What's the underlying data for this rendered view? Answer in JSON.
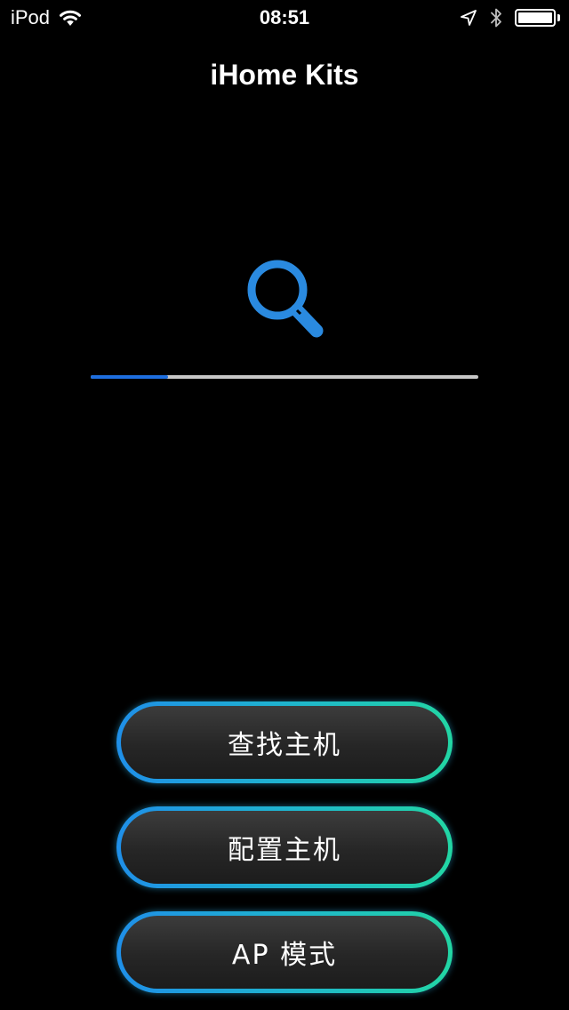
{
  "status_bar": {
    "carrier": "iPod",
    "time": "08:51",
    "icons": [
      "wifi-icon",
      "location-arrow-icon",
      "bluetooth-icon",
      "battery-icon"
    ]
  },
  "nav": {
    "title": "iHome Kits"
  },
  "search": {
    "icon": "search-icon",
    "color": "#2a8ae0",
    "progress_fraction": 0.2
  },
  "buttons": {
    "find_host": "查找主机",
    "config_host": "配置主机",
    "ap_mode": "AP 模式"
  },
  "colors": {
    "background": "#000000",
    "progress_fill": "#1e6fe0",
    "progress_track": "#c8c8c8",
    "button_border_start": "#1f8fe8",
    "button_border_end": "#22d6a4"
  }
}
